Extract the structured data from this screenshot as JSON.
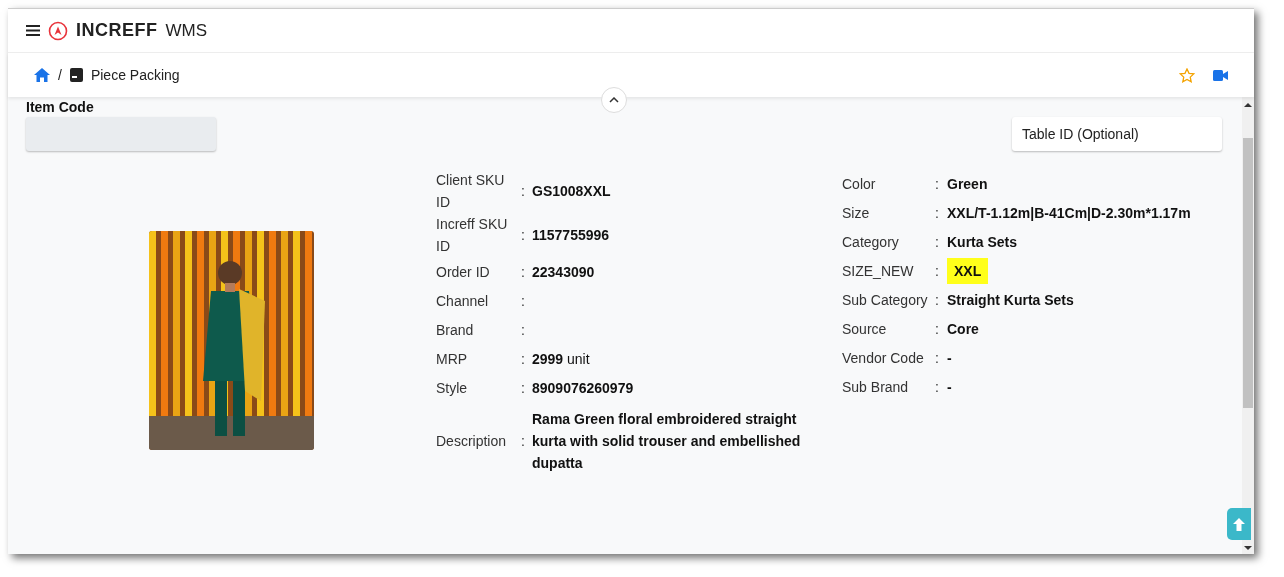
{
  "header": {
    "brand": "INCREFF",
    "product": "WMS"
  },
  "breadcrumb": {
    "separator": "/",
    "page": "Piece Packing"
  },
  "item_code": {
    "label": "Item Code",
    "disabled": true
  },
  "table_id": {
    "placeholder": "Table ID (Optional)"
  },
  "details_left": [
    {
      "label": "Client SKU ID",
      "colon": ":",
      "value": "GS1008XXL"
    },
    {
      "label": "Increff SKU ID",
      "colon": ":",
      "value": "1157755996"
    },
    {
      "label": "Order ID",
      "colon": ":",
      "value": "22343090"
    },
    {
      "label": "Channel",
      "colon": ":"
    },
    {
      "label": "Brand",
      "colon": ":"
    },
    {
      "label": "MRP",
      "colon": ":",
      "value": "2999",
      "unit": "unit"
    },
    {
      "label": "Style",
      "colon": ":",
      "value": "8909076260979"
    },
    {
      "label": "Description",
      "colon": ":",
      "value": "Rama Green floral embroidered straight kurta with solid trouser and embellished dupatta"
    }
  ],
  "details_right": [
    {
      "label": "Color",
      "colon": ":",
      "value": "Green",
      "highlight": false
    },
    {
      "label": "Size",
      "colon": ":",
      "value": "XXL/T-1.12m|B-41Cm|D-2.30m*1.17m",
      "highlight": false
    },
    {
      "label": "Category",
      "colon": ":",
      "value": "Kurta Sets",
      "highlight": false
    },
    {
      "label": "SIZE_NEW",
      "colon": ":",
      "value": "XXL",
      "highlight": true
    },
    {
      "label": "Sub Category",
      "colon": ":",
      "value": "Straight Kurta Sets",
      "highlight": false
    },
    {
      "label": "Source",
      "colon": ":",
      "value": "Core",
      "highlight": false
    },
    {
      "label": "Vendor Code",
      "colon": ":",
      "value": "-",
      "highlight": false
    },
    {
      "label": "Sub Brand",
      "colon": ":",
      "value": "-",
      "highlight": false
    }
  ]
}
